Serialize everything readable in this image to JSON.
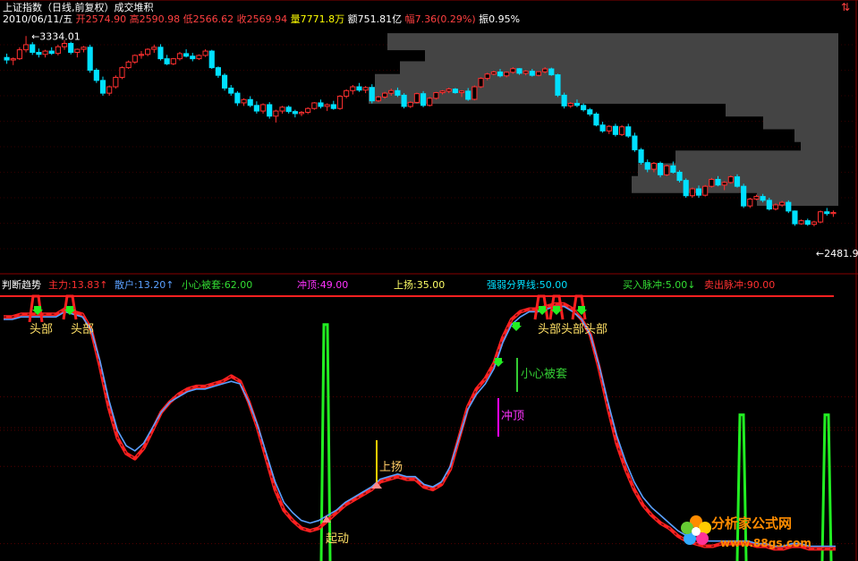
{
  "header_top": {
    "title": "上证指数（日线,前复权）成交堆积",
    "date": "2010/06/11/五",
    "open_label": "开",
    "open": "2574.90",
    "high_label": "高",
    "high": "2590.98",
    "low_label": "低",
    "low": "2566.62",
    "close_label": "收",
    "close": "2569.94",
    "volume_label": "量",
    "volume": "7771.8万",
    "amount_label": "额",
    "amount": "751.81亿",
    "change_label": "幅",
    "change": "7.36(0.29%)",
    "amplitude_label": "振",
    "amplitude": "0.95%"
  },
  "header_bottom": {
    "indicator": "判断趋势",
    "main_force": "主力:13.83↑",
    "retail": "散户:13.20↑",
    "careful_trap": "小心被套:62.00",
    "rush_top": "冲顶:49.00",
    "rise": "上扬:35.00",
    "strong_weak_line": "强弱分界线:50.00",
    "buy_pulse": "买入脉冲:5.00↓",
    "sell_pulse": "卖出脉冲:90.00"
  },
  "colors": {
    "bg": "#000000",
    "up": "#ff3030",
    "down": "#00e0ff",
    "volume_bar": "#444444",
    "main_force": "#ff2020",
    "retail": "#5aa0ff",
    "buy_pulse": "#22ee22",
    "rise_line": "#ffcc00",
    "rush_top_line": "#ff00ff",
    "careful_line": "#33cc33",
    "arrow_green": "#22ee22"
  },
  "chart_data": [
    {
      "type": "candlestick",
      "title": "上证指数（日线,前复权）成交堆积",
      "annotations": [
        "3334.01",
        "2481.97"
      ],
      "high_mark": 3334.01,
      "low_mark": 2481.97,
      "ylim": [
        2430,
        3370
      ],
      "candles": [
        [
          3250,
          3265,
          3225,
          3240
        ],
        [
          3240,
          3250,
          3220,
          3245
        ],
        [
          3245,
          3290,
          3240,
          3280
        ],
        [
          3280,
          3334,
          3270,
          3300
        ],
        [
          3300,
          3310,
          3260,
          3270
        ],
        [
          3270,
          3285,
          3250,
          3262
        ],
        [
          3262,
          3280,
          3250,
          3275
        ],
        [
          3275,
          3290,
          3260,
          3266
        ],
        [
          3266,
          3300,
          3258,
          3292
        ],
        [
          3292,
          3318,
          3280,
          3305
        ],
        [
          3305,
          3312,
          3262,
          3270
        ],
        [
          3270,
          3285,
          3250,
          3282
        ],
        [
          3282,
          3295,
          3270,
          3290
        ],
        [
          3290,
          3300,
          3190,
          3200
        ],
        [
          3200,
          3208,
          3150,
          3160
        ],
        [
          3160,
          3175,
          3100,
          3110
        ],
        [
          3110,
          3140,
          3100,
          3135
        ],
        [
          3135,
          3180,
          3128,
          3172
        ],
        [
          3172,
          3215,
          3165,
          3210
        ],
        [
          3210,
          3238,
          3205,
          3232
        ],
        [
          3232,
          3262,
          3225,
          3258
        ],
        [
          3258,
          3275,
          3245,
          3262
        ],
        [
          3262,
          3286,
          3255,
          3282
        ],
        [
          3282,
          3300,
          3268,
          3290
        ],
        [
          3290,
          3302,
          3238,
          3245
        ],
        [
          3245,
          3260,
          3220,
          3225
        ],
        [
          3225,
          3248,
          3220,
          3245
        ],
        [
          3245,
          3272,
          3238,
          3265
        ],
        [
          3265,
          3282,
          3250,
          3255
        ],
        [
          3255,
          3268,
          3235,
          3245
        ],
        [
          3245,
          3262,
          3240,
          3258
        ],
        [
          3258,
          3282,
          3252,
          3275
        ],
        [
          3275,
          3280,
          3205,
          3210
        ],
        [
          3210,
          3215,
          3170,
          3180
        ],
        [
          3180,
          3188,
          3120,
          3130
        ],
        [
          3130,
          3142,
          3100,
          3110
        ],
        [
          3110,
          3118,
          3060,
          3072
        ],
        [
          3072,
          3090,
          3060,
          3085
        ],
        [
          3085,
          3098,
          3055,
          3062
        ],
        [
          3062,
          3078,
          3030,
          3040
        ],
        [
          3040,
          3070,
          3030,
          3065
        ],
        [
          3065,
          3075,
          3010,
          3020
        ],
        [
          3020,
          3045,
          2995,
          3040
        ],
        [
          3040,
          3060,
          3030,
          3055
        ],
        [
          3055,
          3062,
          3030,
          3038
        ],
        [
          3038,
          3045,
          3015,
          3030
        ],
        [
          3030,
          3040,
          3020,
          3035
        ],
        [
          3035,
          3055,
          3028,
          3050
        ],
        [
          3050,
          3075,
          3045,
          3072
        ],
        [
          3072,
          3085,
          3050,
          3058
        ],
        [
          3058,
          3070,
          3040,
          3065
        ],
        [
          3065,
          3080,
          3045,
          3050
        ],
        [
          3050,
          3102,
          3045,
          3098
        ],
        [
          3098,
          3125,
          3090,
          3120
        ],
        [
          3120,
          3142,
          3105,
          3135
        ],
        [
          3135,
          3150,
          3115,
          3122
        ],
        [
          3122,
          3138,
          3110,
          3132
        ],
        [
          3132,
          3145,
          3070,
          3080
        ],
        [
          3080,
          3100,
          3075,
          3095
        ],
        [
          3095,
          3115,
          3088,
          3110
        ],
        [
          3110,
          3128,
          3100,
          3120
        ],
        [
          3120,
          3132,
          3095,
          3102
        ],
        [
          3102,
          3110,
          3050,
          3058
        ],
        [
          3058,
          3078,
          3052,
          3074
        ],
        [
          3074,
          3112,
          3070,
          3108
        ],
        [
          3108,
          3118,
          3055,
          3062
        ],
        [
          3062,
          3095,
          3058,
          3090
        ],
        [
          3090,
          3115,
          3085,
          3112
        ],
        [
          3112,
          3122,
          3105,
          3118
        ],
        [
          3118,
          3132,
          3110,
          3126
        ],
        [
          3126,
          3130,
          3108,
          3112
        ],
        [
          3112,
          3122,
          3095,
          3118
        ],
        [
          3118,
          3130,
          3080,
          3086
        ],
        [
          3086,
          3140,
          3082,
          3135
        ],
        [
          3135,
          3172,
          3130,
          3168
        ],
        [
          3168,
          3190,
          3160,
          3185
        ],
        [
          3185,
          3198,
          3180,
          3193
        ],
        [
          3193,
          3205,
          3172,
          3178
        ],
        [
          3178,
          3195,
          3172,
          3192
        ],
        [
          3192,
          3212,
          3186,
          3206
        ],
        [
          3206,
          3208,
          3182,
          3188
        ],
        [
          3188,
          3200,
          3180,
          3196
        ],
        [
          3196,
          3205,
          3175,
          3180
        ],
        [
          3180,
          3196,
          3176,
          3194
        ],
        [
          3194,
          3212,
          3188,
          3205
        ],
        [
          3205,
          3210,
          3178,
          3182
        ],
        [
          3182,
          3186,
          3095,
          3102
        ],
        [
          3102,
          3112,
          3050,
          3060
        ],
        [
          3060,
          3075,
          3052,
          3070
        ],
        [
          3070,
          3085,
          3055,
          3062
        ],
        [
          3062,
          3070,
          3038,
          3045
        ],
        [
          3045,
          3052,
          3020,
          3028
        ],
        [
          3028,
          3035,
          2980,
          2985
        ],
        [
          2985,
          2998,
          2955,
          2962
        ],
        [
          2962,
          2985,
          2950,
          2980
        ],
        [
          2980,
          2990,
          2940,
          2948
        ],
        [
          2948,
          2985,
          2942,
          2978
        ],
        [
          2978,
          2990,
          2935,
          2942
        ],
        [
          2942,
          2955,
          2880,
          2888
        ],
        [
          2888,
          2895,
          2830,
          2838
        ],
        [
          2838,
          2850,
          2800,
          2812
        ],
        [
          2812,
          2840,
          2800,
          2835
        ],
        [
          2835,
          2842,
          2780,
          2790
        ],
        [
          2790,
          2830,
          2785,
          2825
        ],
        [
          2825,
          2842,
          2795,
          2800
        ],
        [
          2800,
          2808,
          2760,
          2768
        ],
        [
          2768,
          2776,
          2700,
          2708
        ],
        [
          2708,
          2740,
          2700,
          2735
        ],
        [
          2735,
          2748,
          2700,
          2710
        ],
        [
          2710,
          2750,
          2705,
          2745
        ],
        [
          2745,
          2778,
          2740,
          2772
        ],
        [
          2772,
          2785,
          2745,
          2750
        ],
        [
          2750,
          2765,
          2730,
          2760
        ],
        [
          2760,
          2788,
          2755,
          2782
        ],
        [
          2782,
          2792,
          2740,
          2745
        ],
        [
          2745,
          2755,
          2660,
          2668
        ],
        [
          2668,
          2700,
          2660,
          2695
        ],
        [
          2695,
          2712,
          2690,
          2705
        ],
        [
          2705,
          2715,
          2682,
          2690
        ],
        [
          2690,
          2700,
          2650,
          2656
        ],
        [
          2656,
          2678,
          2650,
          2672
        ],
        [
          2672,
          2688,
          2664,
          2682
        ],
        [
          2682,
          2690,
          2640,
          2648
        ],
        [
          2648,
          2650,
          2590,
          2598
        ],
        [
          2598,
          2615,
          2594,
          2610
        ],
        [
          2610,
          2618,
          2590,
          2596
        ],
        [
          2596,
          2610,
          2588,
          2605
        ],
        [
          2605,
          2650,
          2600,
          2645
        ],
        [
          2645,
          2660,
          2630,
          2638
        ],
        [
          2638,
          2650,
          2625,
          2642
        ]
      ],
      "volume_bars": [
        {
          "price": 3310,
          "value": 0.72
        },
        {
          "price": 3250,
          "value": 0.66
        },
        {
          "price": 3200,
          "value": 0.7
        },
        {
          "price": 3150,
          "value": 0.74
        },
        {
          "price": 3100,
          "value": 0.75
        },
        {
          "price": 3050,
          "value": 0.18
        },
        {
          "price": 3000,
          "value": 0.12
        },
        {
          "price": 2950,
          "value": 0.07
        },
        {
          "price": 2900,
          "value": 0.06
        },
        {
          "price": 2850,
          "value": 0.26
        },
        {
          "price": 2800,
          "value": 0.32
        },
        {
          "price": 2750,
          "value": 0.33
        },
        {
          "price": 2700,
          "value": 0.13
        }
      ]
    },
    {
      "type": "line",
      "title": "判断趋势",
      "ylim": [
        0,
        100
      ],
      "reference_lines": [
        62,
        50,
        49,
        35,
        5,
        90
      ],
      "series": [
        {
          "name": "主力",
          "last": 13.83
        },
        {
          "name": "散户",
          "last": 13.2
        }
      ],
      "x": [
        0,
        10,
        20,
        30,
        40,
        50,
        60,
        70,
        80,
        90,
        100,
        110,
        120,
        130,
        140,
        150,
        160,
        170,
        180,
        190,
        200,
        210,
        220,
        230,
        240,
        250,
        260,
        270,
        280,
        290,
        300,
        310,
        320,
        330,
        340,
        350,
        360,
        370,
        380,
        390,
        400,
        410,
        420,
        430,
        440,
        450,
        460,
        470,
        480,
        490,
        500,
        510,
        520,
        530,
        540,
        550,
        560,
        570,
        580,
        590,
        600,
        610,
        620,
        630,
        640,
        650,
        660,
        670,
        680,
        690,
        700,
        710,
        720,
        730,
        740,
        750,
        760,
        770,
        780,
        790,
        800,
        810,
        820,
        830,
        840,
        850,
        860,
        870,
        880,
        890,
        900,
        910,
        920,
        930,
        940,
        950
      ],
      "main_force": [
        93,
        93,
        94,
        94,
        94,
        94,
        94,
        96,
        95,
        94,
        88,
        74,
        58,
        46,
        40,
        38,
        42,
        49,
        56,
        60,
        63,
        65,
        66,
        66,
        67,
        68,
        70,
        68,
        60,
        50,
        38,
        26,
        18,
        14,
        11,
        10,
        11,
        14,
        17,
        20,
        22,
        24,
        26,
        29,
        30,
        31,
        30,
        30,
        27,
        26,
        28,
        34,
        46,
        58,
        65,
        69,
        75,
        85,
        92,
        95,
        96,
        96,
        97,
        98,
        98,
        96,
        92,
        86,
        73,
        58,
        44,
        34,
        26,
        20,
        16,
        13,
        11,
        8,
        6,
        5,
        4,
        4,
        5,
        5,
        5,
        5,
        4,
        4,
        3,
        3,
        4,
        4,
        3,
        3,
        3,
        3
      ],
      "retail": [
        92,
        92,
        93,
        93,
        93,
        93,
        93,
        95,
        94,
        93,
        88,
        76,
        61,
        49,
        43,
        41,
        44,
        50,
        56,
        60,
        62,
        64,
        65,
        65,
        66,
        67,
        68,
        67,
        60,
        51,
        40,
        29,
        21,
        17,
        14,
        13,
        14,
        16,
        18,
        21,
        23,
        25,
        27,
        30,
        31,
        32,
        31,
        31,
        28,
        27,
        29,
        35,
        46,
        57,
        63,
        67,
        73,
        83,
        90,
        93,
        95,
        95,
        96,
        97,
        97,
        95,
        92,
        86,
        74,
        60,
        47,
        37,
        29,
        23,
        19,
        16,
        13,
        10,
        8,
        7,
        6,
        6,
        6,
        6,
        6,
        6,
        5,
        5,
        4,
        4,
        5,
        5,
        4,
        4,
        4,
        4
      ]
    }
  ],
  "labels": {
    "top_a": "头部",
    "top_b": "头部",
    "top_c": "头部",
    "top_d": "头部",
    "top_e": "头部",
    "careful": "小心被套",
    "rush_top": "冲顶",
    "rise": "上扬",
    "start": "起动"
  },
  "watermark": {
    "name": "分析家公式网",
    "url": "www.88gs.com"
  }
}
